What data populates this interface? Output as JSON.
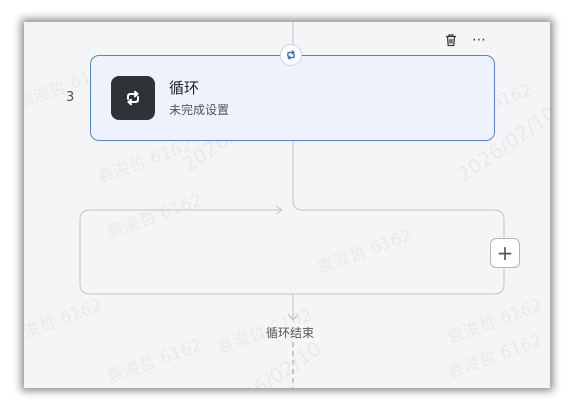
{
  "step": {
    "number": "3"
  },
  "node": {
    "title": "循环",
    "subtitle": "未完成设置",
    "icon": "loop-icon"
  },
  "toolbar": {
    "delete_icon": "trash-icon",
    "more_label": "⋯"
  },
  "loop_end": {
    "label": "循环结束"
  },
  "add_button": {
    "label": "+"
  },
  "watermark": {
    "name": "袁浚哲 6162",
    "date": "2026/02/10"
  },
  "colors": {
    "accent_border": "#5a83c9",
    "card_background": "#edf2fd",
    "icon_tile": "#2f3338",
    "canvas_background": "#f5f5f7"
  }
}
